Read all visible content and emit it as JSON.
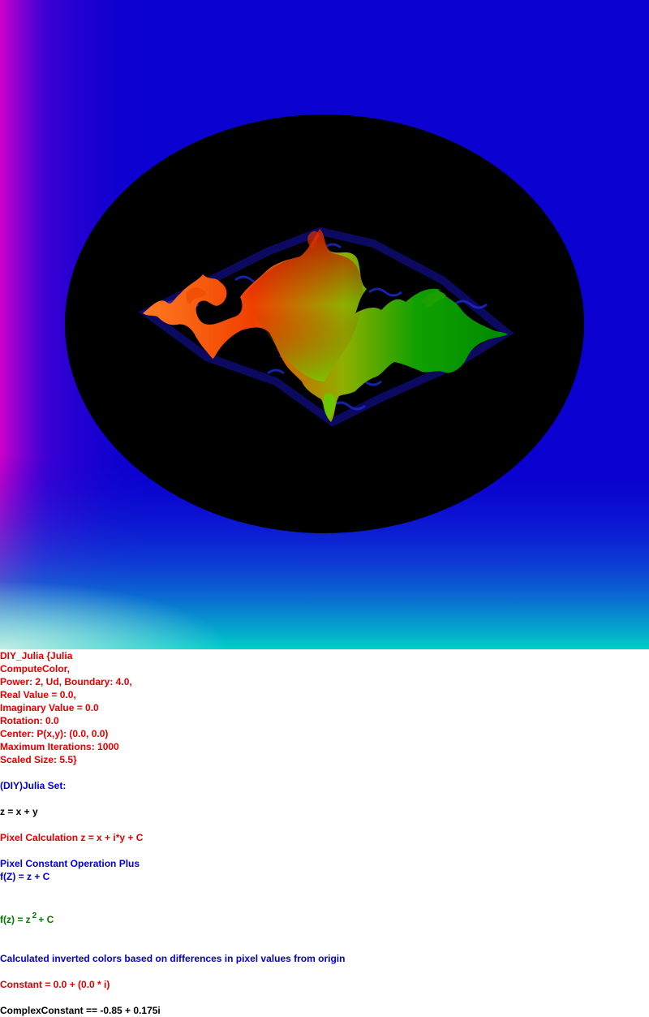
{
  "params": {
    "line1": "DIY_Julia {Julia",
    "line2": "ComputeColor,",
    "line3": "Power: 2, Ud, Boundary: 4.0,",
    "line4": "Real Value = 0.0,",
    "line5": "Imaginary Value = 0.0",
    "line6": "Rotation: 0.0",
    "line7": "Center: P(x,y): (0.0, 0.0)",
    "line8": "Maximum Iterations: 1000",
    "line9": "Scaled Size: 5.5}"
  },
  "set_title": "(DIY)Julia Set:",
  "z_def": "z = x + y",
  "pixel_calc": "Pixel Calculation z = x + i*y + C",
  "pixel_const_op": "Pixel Constant Operation Plus",
  "fz_plus": "f(Z) = z + C",
  "formula": {
    "prefix": "f(z) = z",
    "exponent": "2",
    "suffix": "+ C"
  },
  "color_note": "Calculated inverted colors based on differences in pixel values from origin",
  "constant": "Constant = 0.0 + (0.0 * i)",
  "complex_constant": "ComplexConstant == -0.85 + 0.175i",
  "colors": {
    "background_blue": "#0a00d0",
    "magenta_edge": "#d000c8",
    "cyan_bottom": "#00c8c8",
    "ellipse_fill": "#000000",
    "fractal_left": "#ff5a00",
    "fractal_right": "#009a00",
    "fractal_top": "#c01000",
    "fractal_bottom": "#60e000"
  }
}
